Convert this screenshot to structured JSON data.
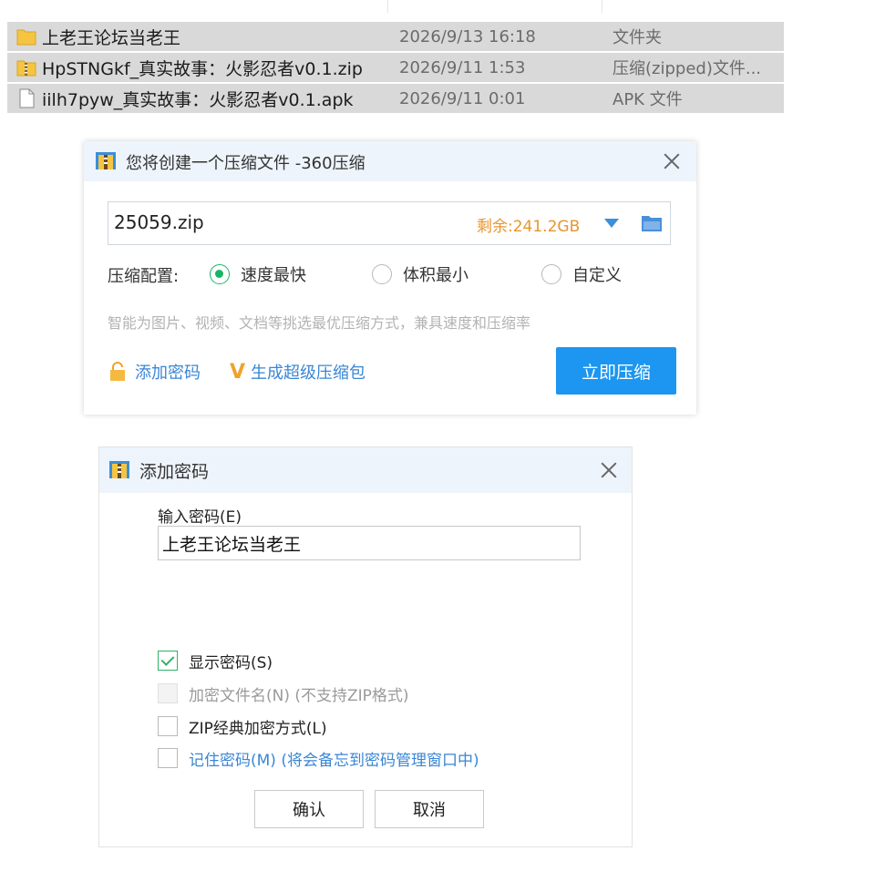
{
  "files": [
    {
      "name": "上老王论坛当老王",
      "date": "2026/9/13 16:18",
      "type": "文件夹",
      "icon": "folder-icon"
    },
    {
      "name": "HpSTNGkf_真实故事：火影忍者v0.1.zip",
      "date": "2026/9/11 1:53",
      "type": "压缩(zipped)文件...",
      "icon": "zip-file-icon"
    },
    {
      "name": "iilh7pyw_真实故事：火影忍者v0.1.apk",
      "date": "2026/9/11 0:01",
      "type": "APK 文件",
      "icon": "document-icon"
    }
  ],
  "compress_dialog": {
    "title": "您将创建一个压缩文件 -360压缩",
    "filename": "25059.zip",
    "remaining": "剩余:241.2GB",
    "config_label": "压缩配置:",
    "options": [
      {
        "label": "速度最快",
        "selected": true
      },
      {
        "label": "体积最小",
        "selected": false
      },
      {
        "label": "自定义",
        "selected": false
      }
    ],
    "hint": "智能为图片、视频、文档等挑选最优压缩方式，兼具速度和压缩率",
    "add_password_link": "添加密码",
    "super_package_link": "生成超级压缩包",
    "super_badge": "V",
    "compress_button": "立即压缩"
  },
  "password_dialog": {
    "title": "添加密码",
    "input_label": "输入密码(E)",
    "password_value": "上老王论坛当老王",
    "checkboxes": [
      {
        "label": "显示密码(S)",
        "checked": true,
        "disabled": false
      },
      {
        "label": "加密文件名(N) (不支持ZIP格式)",
        "checked": false,
        "disabled": true
      },
      {
        "label": "ZIP经典加密方式(L)",
        "checked": false,
        "disabled": false
      },
      {
        "label": "记住密码(M) (将会备忘到密码管理窗口中)",
        "checked": false,
        "disabled": false
      }
    ],
    "ok_button": "确认",
    "cancel_button": "取消"
  },
  "colors": {
    "accent_blue": "#1c96f0",
    "link_blue": "#3a86d4",
    "remaining_orange": "#e8952c",
    "radio_green": "#19b567",
    "row_selected": "#d9d9d9"
  }
}
